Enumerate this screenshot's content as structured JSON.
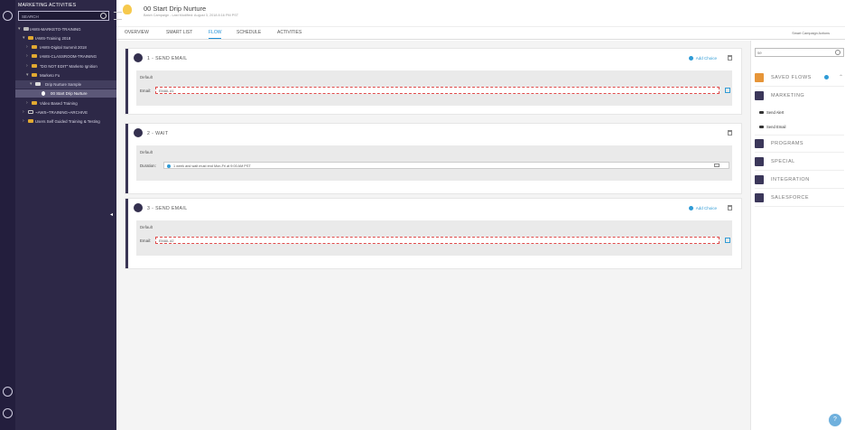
{
  "tree": {
    "title": "MARKETING ACTIVITIES",
    "search_placeholder": "SEARCH",
    "nodes": [
      {
        "label": "IAWS-MARKETO-TRAINING",
        "level": 0,
        "icon": "root"
      },
      {
        "label": "IAWS-Training 2018",
        "level": 1,
        "icon": "folder",
        "expanded": true
      },
      {
        "label": "IAWS-Digital Summit 2018",
        "level": 2,
        "icon": "folder"
      },
      {
        "label": "IAWS-CLASSROOM-TRAINING",
        "level": 2,
        "icon": "folder"
      },
      {
        "label": "\"DO NOT EDIT\" Marketo Ignition",
        "level": 2,
        "icon": "folder"
      },
      {
        "label": "Marketo Fu",
        "level": 2,
        "icon": "folder",
        "expanded": true
      },
      {
        "label": "Drip Nurture Sample",
        "level": 3,
        "icon": "program",
        "expanded": true
      },
      {
        "label": "00 Start Drip Nurture",
        "level": 4,
        "icon": "campaign",
        "selected": true
      },
      {
        "label": "Video Based Training",
        "level": 2,
        "icon": "folder"
      },
      {
        "label": "~AWS~TRAINING~ARCHIVE",
        "level": 1,
        "icon": "archive"
      },
      {
        "label": "Users Self Guided Training & Testing",
        "level": 1,
        "icon": "folder"
      }
    ]
  },
  "header": {
    "title": "00 Start Drip Nurture",
    "subtitle": "Batch Campaign - Last Modified: August 3, 2018 8:16 PM PST"
  },
  "tabs": [
    {
      "label": "OVERVIEW"
    },
    {
      "label": "SMART LIST"
    },
    {
      "label": "FLOW",
      "active": true
    },
    {
      "label": "SCHEDULE"
    },
    {
      "label": "ACTIVITIES"
    }
  ],
  "actions_label": "Smart Campaign Actions",
  "flow": {
    "steps": [
      {
        "name": "1 - SEND EMAIL",
        "icon": "email-icon",
        "add_choice": "Add Choice",
        "choice_label": "Default",
        "field_label": "Email:",
        "field_value": "EMAIL #1"
      },
      {
        "name": "2 - WAIT",
        "icon": "wait-icon",
        "choice_label": "Default",
        "field_label": "Duration:",
        "field_value": "1 week and wait must end Mon-Fri at 9:00 AM PST"
      },
      {
        "name": "3 - SEND EMAIL",
        "icon": "email-icon",
        "add_choice": "Add Choice",
        "choice_label": "Default",
        "field_label": "Email:",
        "field_value": "EMAIL #2"
      }
    ]
  },
  "palette": {
    "search_value": "se",
    "groups": [
      {
        "label": "SAVED FLOWS",
        "icon": "saved-flows-icon"
      },
      {
        "label": "MARKETING",
        "icon": "marketing-icon"
      },
      {
        "label": "PROGRAMS",
        "icon": "programs-icon"
      },
      {
        "label": "SPECIAL",
        "icon": "special-icon"
      },
      {
        "label": "INTEGRATION",
        "icon": "integration-icon"
      },
      {
        "label": "SALESFORCE",
        "icon": "salesforce-icon"
      }
    ],
    "marketing_items": [
      {
        "label": "Send Alert"
      },
      {
        "label": "Send Email"
      }
    ]
  },
  "help_label": "?",
  "colors": {
    "accent": "#1d8fd6",
    "nav_bg": "#2d2847",
    "rail_bg": "#231e3d",
    "folder": "#e1a931",
    "error": "#e04b4b"
  }
}
